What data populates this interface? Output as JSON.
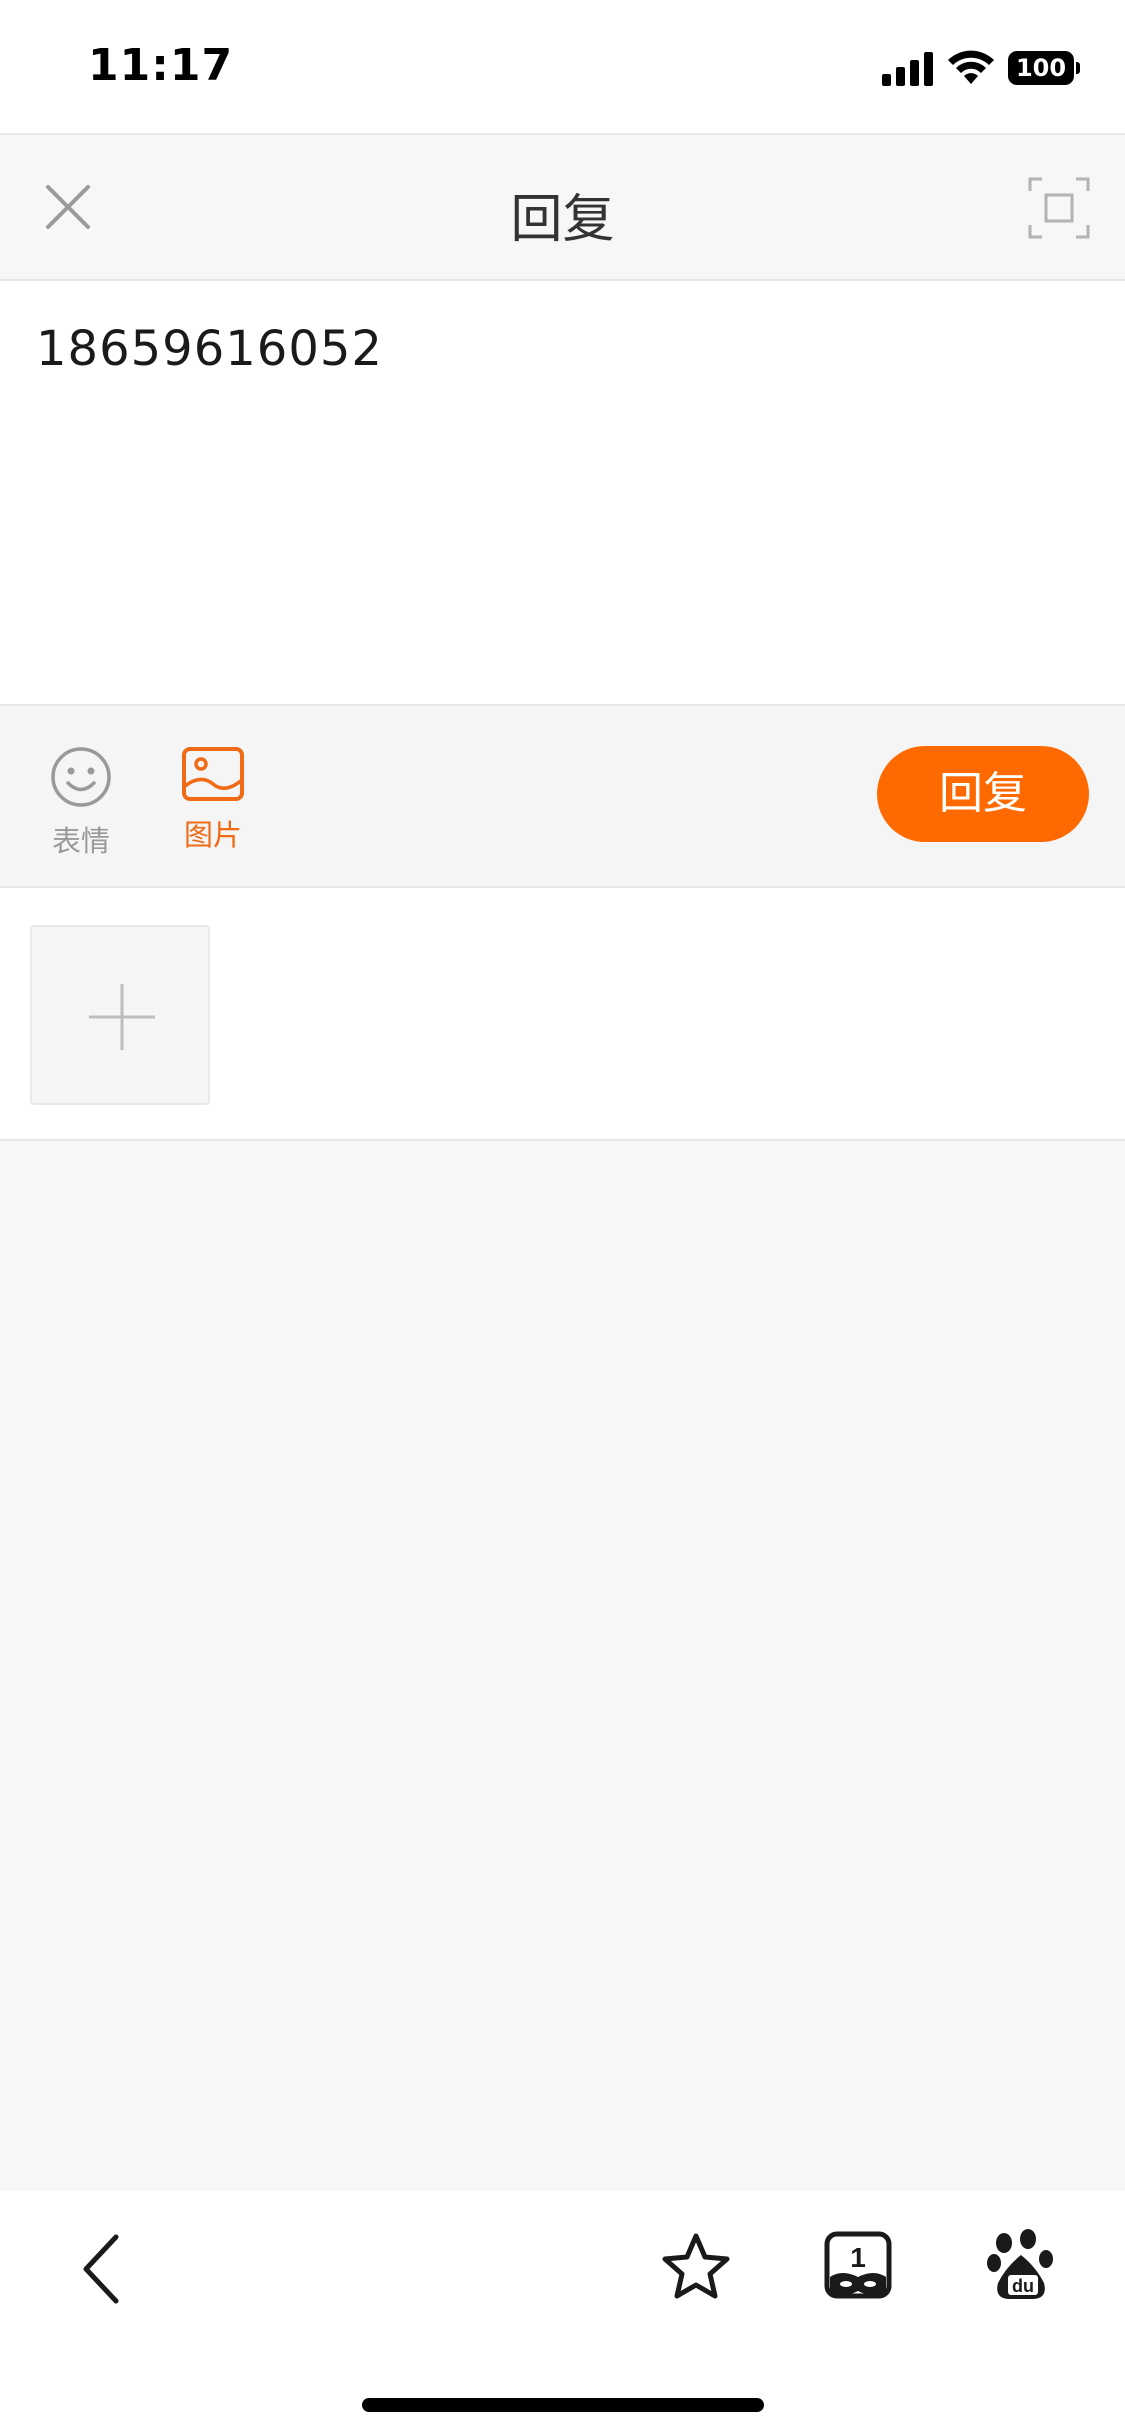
{
  "status_bar": {
    "time": "11:17",
    "battery": "100"
  },
  "header": {
    "title": "回复"
  },
  "editor": {
    "text": "18659616052"
  },
  "toolbar": {
    "emoji_label": "表情",
    "image_label": "图片",
    "reply_label": "回复"
  },
  "colors": {
    "accent": "#ff6a00",
    "active_label": "#f06b16",
    "inactive": "#999999"
  },
  "icons": {
    "close": "close-icon",
    "fullscreen": "fullscreen-icon",
    "emoji": "smiley-icon",
    "image": "image-icon",
    "add": "plus-icon",
    "back": "chevron-left-icon",
    "favorite": "star-icon",
    "tabs": "tab-count-icon",
    "baidu": "baidu-paw-icon"
  },
  "bottom_bar": {
    "tab_count": "1"
  }
}
